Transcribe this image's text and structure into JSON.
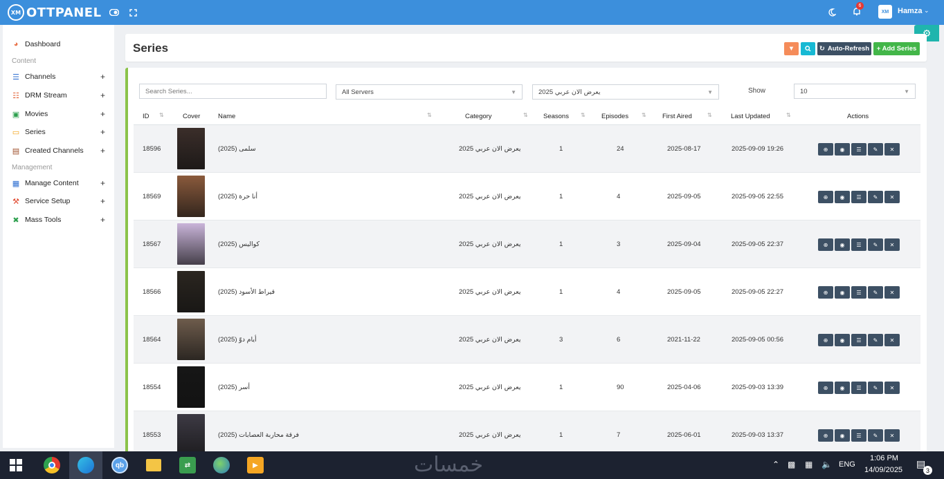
{
  "brand": {
    "logo_text": "XM",
    "name": "OTTPANEL"
  },
  "topbar": {
    "user_name": "Hamza",
    "user_avatar": "XM",
    "notification_count": "6"
  },
  "sidebar": {
    "items": [
      {
        "label": "Dashboard",
        "icon": "dashboard-icon"
      },
      {
        "label": "Channels",
        "icon": "sliders-icon"
      },
      {
        "label": "DRM Stream",
        "icon": "sitemap-icon"
      },
      {
        "label": "Movies",
        "icon": "film-icon"
      },
      {
        "label": "Series",
        "icon": "tv-icon"
      },
      {
        "label": "Created Channels",
        "icon": "file-icon"
      },
      {
        "label": "Manage Content",
        "icon": "table-icon"
      },
      {
        "label": "Service Setup",
        "icon": "wrench-icon"
      },
      {
        "label": "Mass Tools",
        "icon": "tools-icon"
      }
    ],
    "sections": {
      "content": "Content",
      "management": "Management"
    }
  },
  "header": {
    "title": "Series",
    "auto_refresh": "Auto-Refresh",
    "add_series": "+ Add Series"
  },
  "filters": {
    "search_placeholder": "Search Series...",
    "server": "All Servers",
    "category": "يعرض الان عربي 2025",
    "show_label": "Show",
    "show_value": "10"
  },
  "table": {
    "headers": [
      "ID",
      "Cover",
      "Name",
      "Category",
      "Seasons",
      "Episodes",
      "First Aired",
      "Last Updated",
      "Actions"
    ],
    "rows": [
      {
        "id": "18596",
        "name": "سلمى (2025)",
        "category": "يعرض الان عربي 2025",
        "seasons": "1",
        "episodes": "24",
        "first_aired": "2025-08-17",
        "last_updated": "2025-09-09 19:26",
        "cover_color": "#3b2e2a"
      },
      {
        "id": "18569",
        "name": "أنا حرة (2025)",
        "category": "يعرض الان عربي 2025",
        "seasons": "1",
        "episodes": "4",
        "first_aired": "2025-09-05",
        "last_updated": "2025-09-05 22:55",
        "cover_color": "#8a5a3c"
      },
      {
        "id": "18567",
        "name": "كواليس (2025)",
        "category": "يعرض الان عربي 2025",
        "seasons": "1",
        "episodes": "3",
        "first_aired": "2025-09-04",
        "last_updated": "2025-09-05 22:37",
        "cover_color": "#c9b4d9"
      },
      {
        "id": "18566",
        "name": "قيراط الأسود (2025)",
        "category": "يعرض الان عربي 2025",
        "seasons": "1",
        "episodes": "4",
        "first_aired": "2025-09-05",
        "last_updated": "2025-09-05 22:27",
        "cover_color": "#2b2620"
      },
      {
        "id": "18564",
        "name": "أيام دوّ (2025)",
        "category": "يعرض الان عربي 2025",
        "seasons": "3",
        "episodes": "6",
        "first_aired": "2021-11-22",
        "last_updated": "2025-09-05 00:56",
        "cover_color": "#6e5c4c"
      },
      {
        "id": "18554",
        "name": "أسر (2025)",
        "category": "يعرض الان عربي 2025",
        "seasons": "1",
        "episodes": "90",
        "first_aired": "2025-04-06",
        "last_updated": "2025-09-03 13:39",
        "cover_color": "#161616"
      },
      {
        "id": "18553",
        "name": "فرقة محاربة العصابات (2025)",
        "category": "يعرض الان عربي 2025",
        "seasons": "1",
        "episodes": "7",
        "first_aired": "2025-06-01",
        "last_updated": "2025-09-03 13:37",
        "cover_color": "#3d3a44"
      }
    ]
  },
  "taskbar": {
    "apps": [
      "chrome",
      "edge",
      "qb",
      "explorer",
      "transfer",
      "globe",
      "player"
    ],
    "watermark": "خمسات",
    "lang": "ENG",
    "time": "1:06 PM",
    "date": "14/09/2025",
    "notif_count": "3"
  }
}
